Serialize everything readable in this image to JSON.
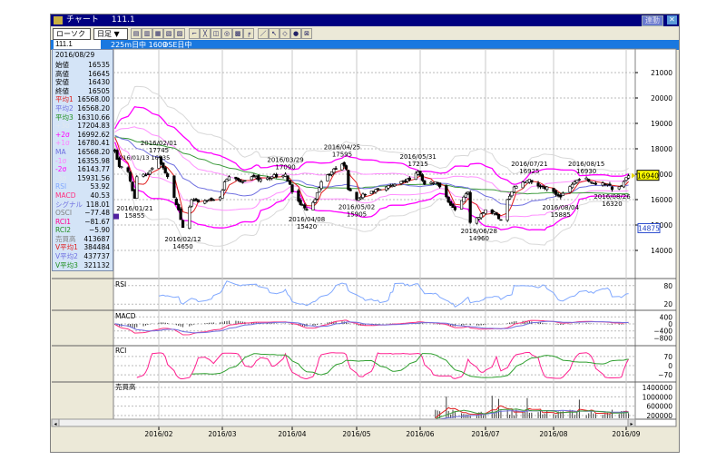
{
  "window": {
    "title": "チャート",
    "title_code": "111.1",
    "link_button": "連動",
    "close_icon": "close-icon"
  },
  "toolbar": {
    "chart_type": "ローソク ▼",
    "period": "日足 ▼",
    "icons": [
      "indicator-icon",
      "chart1-icon",
      "chart2-icon",
      "chart3-icon",
      "chart4-icon",
      "line-tool-icon",
      "fibo-icon",
      "period-icon",
      "zoom-icon",
      "settings-icon",
      "bar-icon",
      "pen-icon",
      "cursor-icon",
      "eraser-icon",
      "search-icon",
      "print-icon"
    ]
  },
  "symbol_bar": {
    "code": "111.1",
    "name": "225m日中 1609",
    "session": "OSE日中"
  },
  "info_panel": {
    "date": "2016/08/29",
    "rows": [
      {
        "label": "始値",
        "value": "16535",
        "color": "#000000"
      },
      {
        "label": "高値",
        "value": "16645",
        "color": "#000000"
      },
      {
        "label": "安値",
        "value": "16430",
        "color": "#000000"
      },
      {
        "label": "終値",
        "value": "16505",
        "color": "#000000"
      },
      {
        "label": "平均1",
        "value": "16568.00",
        "color": "#e02020"
      },
      {
        "label": "平均2",
        "value": "16568.20",
        "color": "#7070e0"
      },
      {
        "label": "平均3",
        "value": "16310.66",
        "color": "#209020"
      },
      {
        "label": "+3σ",
        "value": "17204.83",
        "color": "#e0e8f0"
      },
      {
        "label": "+2σ",
        "value": "16992.62",
        "color": "#ff00ff"
      },
      {
        "label": "+1σ",
        "value": "16780.41",
        "color": "#ff80ff"
      },
      {
        "label": "MA",
        "value": "16568.20",
        "color": "#7070e0"
      },
      {
        "label": "-1σ",
        "value": "16355.98",
        "color": "#ff80ff"
      },
      {
        "label": "-2σ",
        "value": "16143.77",
        "color": "#ff00ff"
      },
      {
        "label": "-3σ",
        "value": "15931.56",
        "color": "#e0e8f0"
      },
      {
        "label": "RSI",
        "value": "53.92",
        "color": "#80a8ff"
      },
      {
        "label": "MACD",
        "value": "40.53",
        "color": "#ff3080"
      },
      {
        "label": "シグナル",
        "value": "118.01",
        "color": "#7070e0"
      },
      {
        "label": "OSCI",
        "value": "−77.48",
        "color": "#808080"
      },
      {
        "label": "RCI1",
        "value": "−81.67",
        "color": "#ff0090"
      },
      {
        "label": "RCI2",
        "value": "−5.90",
        "color": "#209020"
      },
      {
        "label": "売買高",
        "value": "413687",
        "color": "#808080"
      },
      {
        "label": "V平均1",
        "value": "384484",
        "color": "#e02020"
      },
      {
        "label": "V平均2",
        "value": "437737",
        "color": "#7070e0"
      },
      {
        "label": "V平均3",
        "value": "321132",
        "color": "#209020"
      }
    ]
  },
  "chart_data": {
    "type": "candlestick",
    "price_axis": {
      "ticks": [
        21000,
        20000,
        19000,
        18000,
        17000,
        16000,
        15000,
        14000
      ],
      "range": [
        13900,
        21900
      ]
    },
    "current_price_tag": "16940",
    "cursor_price_tag": "14875",
    "x_ticks": [
      "2016/02",
      "2016/03",
      "2016/04",
      "2016/05",
      "2016/06",
      "2016/07",
      "2016/08",
      "2016/09"
    ],
    "approx_closes": [
      [
        "2016-01-12",
        17900
      ],
      [
        "2016-01-14",
        17300
      ],
      [
        "2016-01-18",
        17100
      ],
      [
        "2016-01-21",
        16050
      ],
      [
        "2016-01-22",
        16900
      ],
      [
        "2016-01-27",
        17000
      ],
      [
        "2016-02-01",
        17650
      ],
      [
        "2016-02-03",
        17250
      ],
      [
        "2016-02-05",
        16900
      ],
      [
        "2016-02-09",
        15800
      ],
      [
        "2016-02-10",
        15600
      ],
      [
        "2016-02-12",
        14900
      ],
      [
        "2016-02-16",
        16000
      ],
      [
        "2016-02-19",
        15900
      ],
      [
        "2016-02-24",
        16000
      ],
      [
        "2016-02-29",
        16100
      ],
      [
        "2016-03-02",
        16700
      ],
      [
        "2016-03-04",
        16900
      ],
      [
        "2016-03-09",
        16700
      ],
      [
        "2016-03-14",
        16900
      ],
      [
        "2016-03-18",
        16800
      ],
      [
        "2016-03-23",
        16900
      ],
      [
        "2016-03-29",
        17000
      ],
      [
        "2016-04-01",
        16300
      ],
      [
        "2016-04-05",
        15800
      ],
      [
        "2016-04-08",
        15600
      ],
      [
        "2016-04-12",
        16000
      ],
      [
        "2016-04-15",
        16700
      ],
      [
        "2016-04-20",
        17100
      ],
      [
        "2016-04-25",
        17400
      ],
      [
        "2016-04-27",
        17200
      ],
      [
        "2016-04-28",
        16400
      ],
      [
        "2016-05-02",
        16000
      ],
      [
        "2016-05-06",
        16200
      ],
      [
        "2016-05-11",
        16400
      ],
      [
        "2016-05-16",
        16500
      ],
      [
        "2016-05-20",
        16600
      ],
      [
        "2016-05-25",
        16700
      ],
      [
        "2016-05-31",
        17100
      ],
      [
        "2016-06-03",
        16600
      ],
      [
        "2016-06-08",
        16700
      ],
      [
        "2016-06-10",
        16500
      ],
      [
        "2016-06-14",
        15900
      ],
      [
        "2016-06-17",
        15600
      ],
      [
        "2016-06-21",
        16100
      ],
      [
        "2016-06-23",
        16300
      ],
      [
        "2016-06-24",
        15100
      ],
      [
        "2016-06-28",
        15300
      ],
      [
        "2016-07-01",
        15600
      ],
      [
        "2016-07-06",
        15400
      ],
      [
        "2016-07-08",
        15200
      ],
      [
        "2016-07-11",
        16000
      ],
      [
        "2016-07-14",
        16500
      ],
      [
        "2016-07-19",
        16700
      ],
      [
        "2016-07-21",
        16800
      ],
      [
        "2016-07-26",
        16500
      ],
      [
        "2016-07-29",
        16500
      ],
      [
        "2016-08-02",
        16200
      ],
      [
        "2016-08-04",
        16100
      ],
      [
        "2016-08-09",
        16600
      ],
      [
        "2016-08-12",
        16800
      ],
      [
        "2016-08-15",
        16850
      ],
      [
        "2016-08-19",
        16600
      ],
      [
        "2016-08-24",
        16600
      ],
      [
        "2016-08-26",
        16400
      ],
      [
        "2016-08-29",
        16505
      ],
      [
        "2016-09-02",
        16940
      ]
    ],
    "annotations": [
      {
        "date": "2016-01-21",
        "text": "2016/01/21",
        "value": "15855",
        "side": "low"
      },
      {
        "date": "2016-02-01",
        "text": "2016/02/01",
        "value": "17745",
        "side": "high"
      },
      {
        "date": "2016-02-12",
        "text": "2016/02/12",
        "value": "14650",
        "side": "low"
      },
      {
        "date": "2016-03-29",
        "text": "2016/03/29",
        "value": "17090",
        "side": "high"
      },
      {
        "date": "2016-04-08",
        "text": "2016/04/08",
        "value": "15420",
        "side": "low"
      },
      {
        "date": "2016-04-25",
        "text": "2016/04/25",
        "value": "17595",
        "side": "high"
      },
      {
        "date": "2016-05-02",
        "text": "2016/05/02",
        "value": "15905",
        "side": "low"
      },
      {
        "date": "2016-05-31",
        "text": "2016/05/31",
        "value": "17215",
        "side": "high"
      },
      {
        "date": "2016-06-28",
        "text": "2016/06/28",
        "value": "14960",
        "side": "low"
      },
      {
        "date": "2016-07-21",
        "text": "2016/07/21",
        "value": "16925",
        "side": "high"
      },
      {
        "date": "2016-08-04",
        "text": "2016/08/04",
        "value": "15885",
        "side": "low"
      },
      {
        "date": "2016-08-15",
        "text": "2016/08/15",
        "value": "16930",
        "side": "high"
      },
      {
        "date": "2016-08-26",
        "text": "2016/08/26",
        "value": "16320",
        "side": "low"
      }
    ],
    "start_label": "2016/01/13 16935",
    "panels": {
      "rsi": {
        "label": "RSI",
        "ticks": [
          80,
          20
        ]
      },
      "macd": {
        "label": "MACD",
        "ticks": [
          400,
          0,
          -400,
          -800
        ]
      },
      "rci": {
        "label": "RCI",
        "ticks": [
          70,
          0,
          -70
        ]
      },
      "volume": {
        "label": "売買高",
        "ticks": [
          1400000,
          1000000,
          600000,
          200000
        ]
      }
    },
    "colors": {
      "ma_short": "#e02020",
      "ma_mid": "#7070e0",
      "ma_long": "#3a9a3a",
      "band2": "#ff00ff",
      "band1": "#ff90ff",
      "band3": "#d8d8d8",
      "rsi": "#80a8ff",
      "macd": "#ff3080",
      "signal": "#7070e0",
      "rci1": "#ff2090",
      "rci2": "#30a030"
    }
  }
}
